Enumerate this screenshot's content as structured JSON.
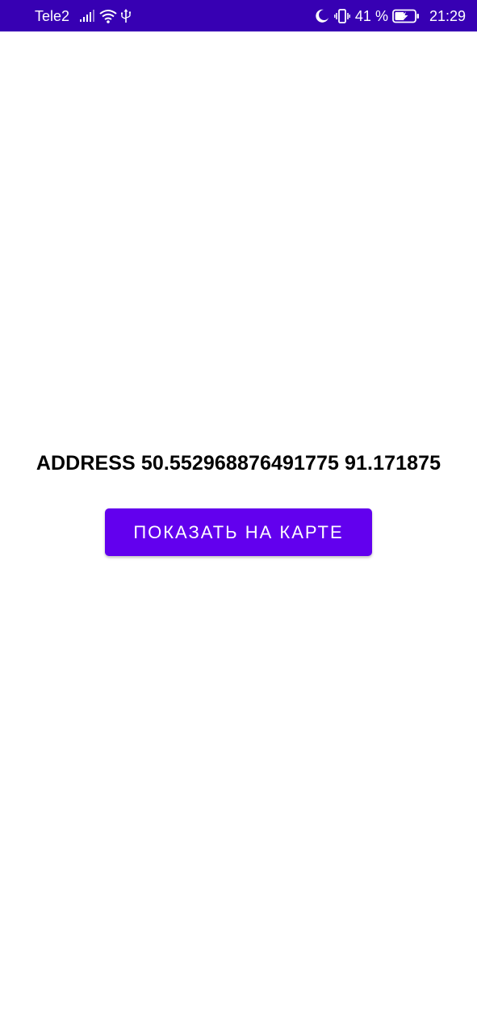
{
  "status_bar": {
    "carrier": "Tele2",
    "battery_percent": "41 %",
    "time": "21:29",
    "background_color": "#3700B3",
    "icons": [
      "signal-icon",
      "wifi-icon",
      "usb-icon",
      "do-not-disturb-moon-icon",
      "vibrate-icon",
      "battery-charging-icon"
    ]
  },
  "main": {
    "address_text": "ADDRESS 50.552968876491775 91.171875",
    "show_on_map_button": "ПОКАЗАТЬ НА КАРТЕ",
    "button_color": "#6200EE"
  }
}
